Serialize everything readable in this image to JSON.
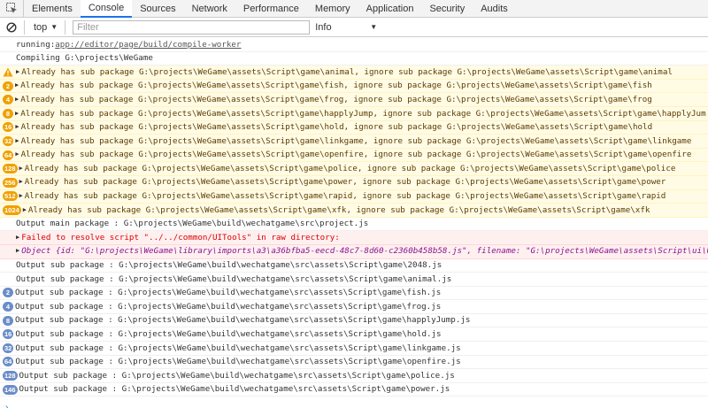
{
  "tabs": [
    "Elements",
    "Console",
    "Sources",
    "Network",
    "Performance",
    "Memory",
    "Application",
    "Security",
    "Audits"
  ],
  "toolbar": {
    "context": "top",
    "filter_placeholder": "Filter",
    "levels": "Info"
  },
  "lines": [
    {
      "kind": "plain",
      "text": "running: ",
      "link": "app://editor/page/build/compile-worker"
    },
    {
      "kind": "plain",
      "text": "Compiling G:\\projects\\WeGame"
    },
    {
      "kind": "warn",
      "badge": "",
      "text": "Already has sub package G:\\projects\\WeGame\\assets\\Script\\game\\animal, ignore sub package G:\\projects\\WeGame\\assets\\Script\\game\\animal"
    },
    {
      "kind": "warn",
      "badge": "2",
      "text": "Already has sub package G:\\projects\\WeGame\\assets\\Script\\game\\fish, ignore sub package G:\\projects\\WeGame\\assets\\Script\\game\\fish"
    },
    {
      "kind": "warn",
      "badge": "4",
      "text": "Already has sub package G:\\projects\\WeGame\\assets\\Script\\game\\frog, ignore sub package G:\\projects\\WeGame\\assets\\Script\\game\\frog"
    },
    {
      "kind": "warn",
      "badge": "8",
      "text": "Already has sub package G:\\projects\\WeGame\\assets\\Script\\game\\happlyJump, ignore sub package G:\\projects\\WeGame\\assets\\Script\\game\\happlyJum"
    },
    {
      "kind": "warn",
      "badge": "16",
      "text": "Already has sub package G:\\projects\\WeGame\\assets\\Script\\game\\hold, ignore sub package G:\\projects\\WeGame\\assets\\Script\\game\\hold"
    },
    {
      "kind": "warn",
      "badge": "32",
      "text": "Already has sub package G:\\projects\\WeGame\\assets\\Script\\game\\linkgame, ignore sub package G:\\projects\\WeGame\\assets\\Script\\game\\linkgame"
    },
    {
      "kind": "warn",
      "badge": "64",
      "text": "Already has sub package G:\\projects\\WeGame\\assets\\Script\\game\\openfire, ignore sub package G:\\projects\\WeGame\\assets\\Script\\game\\openfire"
    },
    {
      "kind": "warn",
      "badge": "128",
      "text": "Already has sub package G:\\projects\\WeGame\\assets\\Script\\game\\police, ignore sub package G:\\projects\\WeGame\\assets\\Script\\game\\police"
    },
    {
      "kind": "warn",
      "badge": "256",
      "text": "Already has sub package G:\\projects\\WeGame\\assets\\Script\\game\\power, ignore sub package G:\\projects\\WeGame\\assets\\Script\\game\\power"
    },
    {
      "kind": "warn",
      "badge": "512",
      "text": "Already has sub package G:\\projects\\WeGame\\assets\\Script\\game\\rapid, ignore sub package G:\\projects\\WeGame\\assets\\Script\\game\\rapid"
    },
    {
      "kind": "warn",
      "badge": "1024",
      "text": "Already has sub package G:\\projects\\WeGame\\assets\\Script\\game\\xfk, ignore sub package G:\\projects\\WeGame\\assets\\Script\\game\\xfk"
    },
    {
      "kind": "plain",
      "text": "Output main package : G:\\projects\\WeGame\\build\\wechatgame\\src\\project.js"
    },
    {
      "kind": "err",
      "text": "Failed to resolve script \"../../common/UITools\" in raw directory:"
    },
    {
      "kind": "errobj",
      "text": "Object {id: \"G:\\projects\\WeGame\\library\\imports\\a3\\a36bfba5-eecd-48c7-8d60-c2360b458b58.js\", filename: \"G:\\projects\\WeGame\\assets\\Script\\ui\\U"
    },
    {
      "kind": "plain",
      "text": "Output sub package : G:\\projects\\WeGame\\build\\wechatgame\\src\\assets\\Script\\game\\2048.js"
    },
    {
      "kind": "plain",
      "text": "Output sub package : G:\\projects\\WeGame\\build\\wechatgame\\src\\assets\\Script\\game\\animal.js"
    },
    {
      "kind": "info",
      "badge": "2",
      "text": "Output sub package : G:\\projects\\WeGame\\build\\wechatgame\\src\\assets\\Script\\game\\fish.js"
    },
    {
      "kind": "info",
      "badge": "4",
      "text": "Output sub package : G:\\projects\\WeGame\\build\\wechatgame\\src\\assets\\Script\\game\\frog.js"
    },
    {
      "kind": "info",
      "badge": "8",
      "text": "Output sub package : G:\\projects\\WeGame\\build\\wechatgame\\src\\assets\\Script\\game\\happlyJump.js"
    },
    {
      "kind": "info",
      "badge": "16",
      "text": "Output sub package : G:\\projects\\WeGame\\build\\wechatgame\\src\\assets\\Script\\game\\hold.js"
    },
    {
      "kind": "info",
      "badge": "32",
      "text": "Output sub package : G:\\projects\\WeGame\\build\\wechatgame\\src\\assets\\Script\\game\\linkgame.js"
    },
    {
      "kind": "info",
      "badge": "64",
      "text": "Output sub package : G:\\projects\\WeGame\\build\\wechatgame\\src\\assets\\Script\\game\\openfire.js"
    },
    {
      "kind": "info",
      "badge": "128",
      "text": "Output sub package : G:\\projects\\WeGame\\build\\wechatgame\\src\\assets\\Script\\game\\police.js"
    },
    {
      "kind": "info",
      "badge": "146",
      "text": "Output sub package : G:\\projects\\WeGame\\build\\wechatgame\\src\\assets\\Script\\game\\power.js"
    }
  ],
  "prompt": "›",
  "colors": {
    "warn_badge": "#f0a000",
    "info_badge": "#6a8dc8",
    "active_tab": "#1a73e8",
    "warn_bg": "#fffbe5",
    "error_text": "#d00000"
  }
}
